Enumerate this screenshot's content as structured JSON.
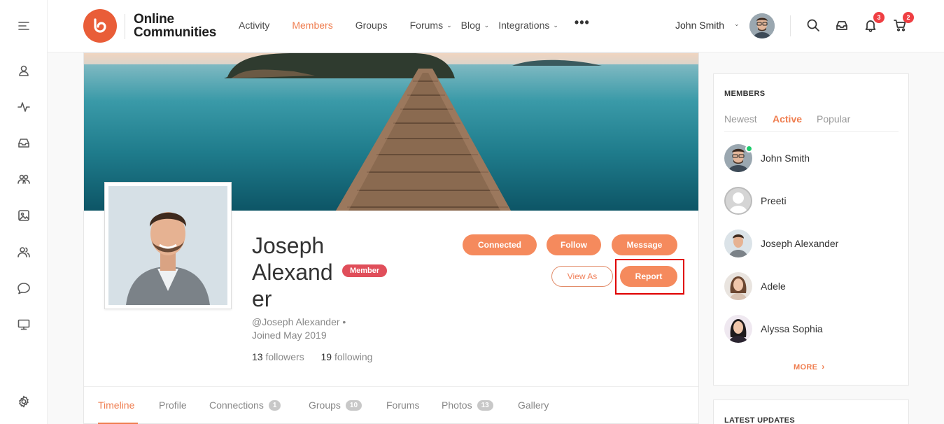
{
  "colors": {
    "accent": "#ef7d4f",
    "button": "#f58a5d",
    "badge": "#e04e5a",
    "online": "#1ccc6c",
    "highlight": "#e00000"
  },
  "sidebar": {
    "icons": [
      "menu-icon",
      "user-icon",
      "activity-icon",
      "inbox-icon",
      "groups-icon",
      "image-icon",
      "members-icon",
      "chat-icon",
      "monitor-icon",
      "settings-icon"
    ]
  },
  "header": {
    "logo_line1": "Online",
    "logo_line2": "Communities",
    "nav": [
      {
        "label": "Activity"
      },
      {
        "label": "Members"
      },
      {
        "label": "Groups"
      },
      {
        "label": "Forums"
      },
      {
        "label": "Blog"
      },
      {
        "label": "Integrations"
      }
    ],
    "more": "•••",
    "user_name": "John Smith",
    "notifications_count": "3",
    "cart_count": "2"
  },
  "profile": {
    "name": "Joseph Alexand er",
    "name_line1": "Joseph",
    "name_line2": "Alexand",
    "name_line3": "er",
    "member_type": "Member",
    "handle": "@Joseph Alexander •",
    "joined": "Joined May 2019",
    "followers_count": "13",
    "followers_label": "followers",
    "following_count": "19",
    "following_label": "following",
    "buttons": {
      "connected": "Connected",
      "follow": "Follow",
      "message": "Message",
      "view_as": "View As",
      "report": "Report"
    },
    "tabs": [
      {
        "label": "Timeline"
      },
      {
        "label": "Profile"
      },
      {
        "label": "Connections",
        "count": "1"
      },
      {
        "label": "Groups",
        "count": "10"
      },
      {
        "label": "Forums"
      },
      {
        "label": "Photos",
        "count": "13"
      },
      {
        "label": "Gallery"
      }
    ]
  },
  "members_widget": {
    "title": "MEMBERS",
    "tabs": [
      "Newest",
      "Active",
      "Popular"
    ],
    "members": [
      {
        "name": "John Smith"
      },
      {
        "name": "Preeti"
      },
      {
        "name": "Joseph Alexander"
      },
      {
        "name": "Adele"
      },
      {
        "name": "Alyssa Sophia"
      }
    ],
    "more": "MORE"
  },
  "updates_widget": {
    "title": "LATEST UPDATES"
  }
}
